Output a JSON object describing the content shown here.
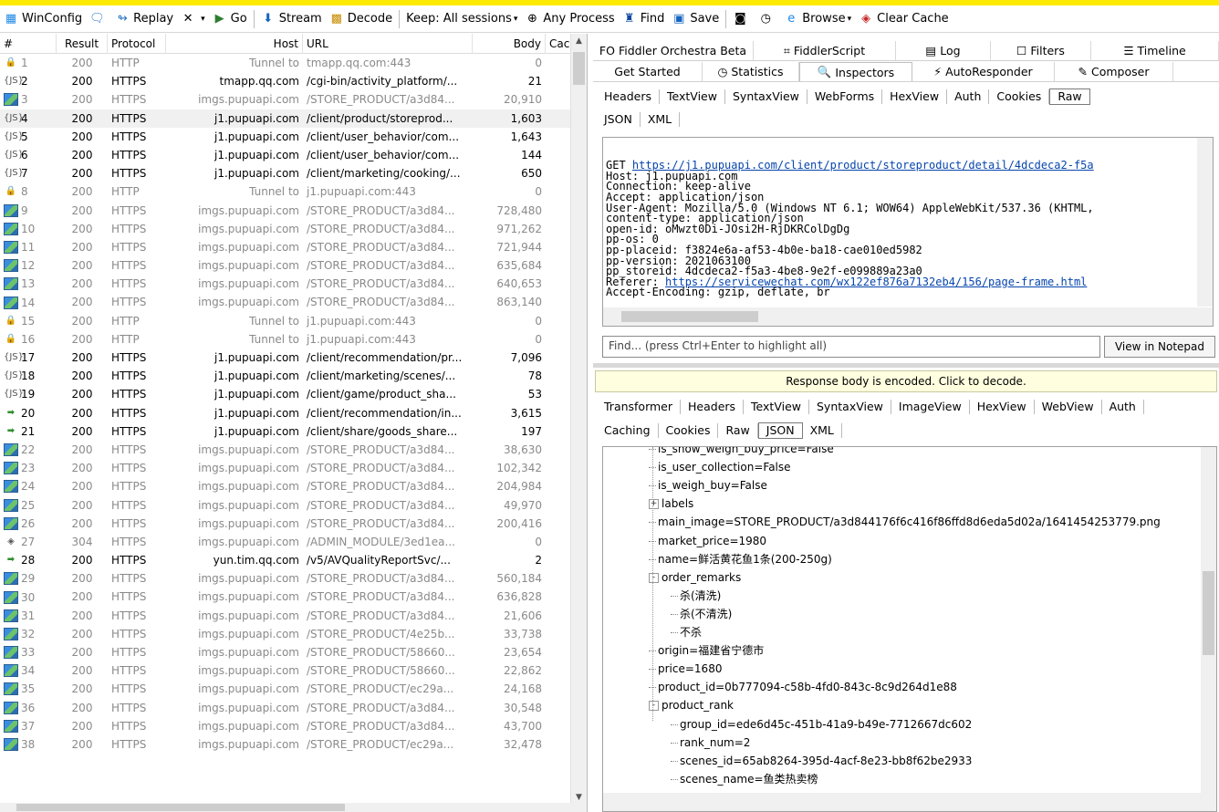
{
  "toolbar": {
    "winconfig": "WinConfig",
    "replay": "Replay",
    "go": "Go",
    "stream": "Stream",
    "decode": "Decode",
    "keep": "Keep: All sessions",
    "any_process": "Any Process",
    "find": "Find",
    "save": "Save",
    "browse": "Browse",
    "clear_cache": "Clear Cache"
  },
  "columns": [
    "#",
    "Result",
    "Protocol",
    "Host",
    "URL",
    "Body",
    "Cach"
  ],
  "sessions": [
    {
      "num": "1",
      "icon": "lock",
      "result": "200",
      "protocol": "HTTP",
      "host": "Tunnel to",
      "url": "tmapp.qq.com:443",
      "body": "0",
      "gray": true
    },
    {
      "num": "2",
      "icon": "json",
      "result": "200",
      "protocol": "HTTPS",
      "host": "tmapp.qq.com",
      "url": "/cgi-bin/activity_platform/...",
      "body": "21",
      "gray": false
    },
    {
      "num": "3",
      "icon": "img",
      "result": "200",
      "protocol": "HTTPS",
      "host": "imgs.pupuapi.com",
      "url": "/STORE_PRODUCT/a3d84...",
      "body": "20,910",
      "gray": true
    },
    {
      "num": "4",
      "icon": "json",
      "result": "200",
      "protocol": "HTTPS",
      "host": "j1.pupuapi.com",
      "url": "/client/product/storeprod...",
      "body": "1,603",
      "gray": false,
      "selected": true
    },
    {
      "num": "5",
      "icon": "json",
      "result": "200",
      "protocol": "HTTPS",
      "host": "j1.pupuapi.com",
      "url": "/client/user_behavior/com...",
      "body": "1,643",
      "gray": false
    },
    {
      "num": "6",
      "icon": "json",
      "result": "200",
      "protocol": "HTTPS",
      "host": "j1.pupuapi.com",
      "url": "/client/user_behavior/com...",
      "body": "144",
      "gray": false
    },
    {
      "num": "7",
      "icon": "json",
      "result": "200",
      "protocol": "HTTPS",
      "host": "j1.pupuapi.com",
      "url": "/client/marketing/cooking/...",
      "body": "650",
      "gray": false
    },
    {
      "num": "8",
      "icon": "lock",
      "result": "200",
      "protocol": "HTTP",
      "host": "Tunnel to",
      "url": "j1.pupuapi.com:443",
      "body": "0",
      "gray": true
    },
    {
      "num": "9",
      "icon": "img",
      "result": "200",
      "protocol": "HTTPS",
      "host": "imgs.pupuapi.com",
      "url": "/STORE_PRODUCT/a3d84...",
      "body": "728,480",
      "gray": true
    },
    {
      "num": "10",
      "icon": "img",
      "result": "200",
      "protocol": "HTTPS",
      "host": "imgs.pupuapi.com",
      "url": "/STORE_PRODUCT/a3d84...",
      "body": "971,262",
      "gray": true
    },
    {
      "num": "11",
      "icon": "img",
      "result": "200",
      "protocol": "HTTPS",
      "host": "imgs.pupuapi.com",
      "url": "/STORE_PRODUCT/a3d84...",
      "body": "721,944",
      "gray": true
    },
    {
      "num": "12",
      "icon": "img",
      "result": "200",
      "protocol": "HTTPS",
      "host": "imgs.pupuapi.com",
      "url": "/STORE_PRODUCT/a3d84...",
      "body": "635,684",
      "gray": true
    },
    {
      "num": "13",
      "icon": "img",
      "result": "200",
      "protocol": "HTTPS",
      "host": "imgs.pupuapi.com",
      "url": "/STORE_PRODUCT/a3d84...",
      "body": "640,653",
      "gray": true
    },
    {
      "num": "14",
      "icon": "img",
      "result": "200",
      "protocol": "HTTPS",
      "host": "imgs.pupuapi.com",
      "url": "/STORE_PRODUCT/a3d84...",
      "body": "863,140",
      "gray": true
    },
    {
      "num": "15",
      "icon": "lock",
      "result": "200",
      "protocol": "HTTP",
      "host": "Tunnel to",
      "url": "j1.pupuapi.com:443",
      "body": "0",
      "gray": true
    },
    {
      "num": "16",
      "icon": "lock",
      "result": "200",
      "protocol": "HTTP",
      "host": "Tunnel to",
      "url": "j1.pupuapi.com:443",
      "body": "0",
      "gray": true
    },
    {
      "num": "17",
      "icon": "json",
      "result": "200",
      "protocol": "HTTPS",
      "host": "j1.pupuapi.com",
      "url": "/client/recommendation/pr...",
      "body": "7,096",
      "gray": false
    },
    {
      "num": "18",
      "icon": "json",
      "result": "200",
      "protocol": "HTTPS",
      "host": "j1.pupuapi.com",
      "url": "/client/marketing/scenes/...",
      "body": "78",
      "gray": false
    },
    {
      "num": "19",
      "icon": "json",
      "result": "200",
      "protocol": "HTTPS",
      "host": "j1.pupuapi.com",
      "url": "/client/game/product_sha...",
      "body": "53",
      "gray": false
    },
    {
      "num": "20",
      "icon": "arrow",
      "result": "200",
      "protocol": "HTTPS",
      "host": "j1.pupuapi.com",
      "url": "/client/recommendation/in...",
      "body": "3,615",
      "gray": false
    },
    {
      "num": "21",
      "icon": "arrow",
      "result": "200",
      "protocol": "HTTPS",
      "host": "j1.pupuapi.com",
      "url": "/client/share/goods_share...",
      "body": "197",
      "gray": false
    },
    {
      "num": "22",
      "icon": "img",
      "result": "200",
      "protocol": "HTTPS",
      "host": "imgs.pupuapi.com",
      "url": "/STORE_PRODUCT/a3d84...",
      "body": "38,630",
      "gray": true
    },
    {
      "num": "23",
      "icon": "img",
      "result": "200",
      "protocol": "HTTPS",
      "host": "imgs.pupuapi.com",
      "url": "/STORE_PRODUCT/a3d84...",
      "body": "102,342",
      "gray": true
    },
    {
      "num": "24",
      "icon": "img",
      "result": "200",
      "protocol": "HTTPS",
      "host": "imgs.pupuapi.com",
      "url": "/STORE_PRODUCT/a3d84...",
      "body": "204,984",
      "gray": true
    },
    {
      "num": "25",
      "icon": "img",
      "result": "200",
      "protocol": "HTTPS",
      "host": "imgs.pupuapi.com",
      "url": "/STORE_PRODUCT/a3d84...",
      "body": "49,970",
      "gray": true
    },
    {
      "num": "26",
      "icon": "img",
      "result": "200",
      "protocol": "HTTPS",
      "host": "imgs.pupuapi.com",
      "url": "/STORE_PRODUCT/a3d84...",
      "body": "200,416",
      "gray": true
    },
    {
      "num": "27",
      "icon": "304",
      "result": "304",
      "protocol": "HTTPS",
      "host": "imgs.pupuapi.com",
      "url": "/ADMIN_MODULE/3ed1ea...",
      "body": "0",
      "gray": true
    },
    {
      "num": "28",
      "icon": "arrow",
      "result": "200",
      "protocol": "HTTPS",
      "host": "yun.tim.qq.com",
      "url": "/v5/AVQualityReportSvc/...",
      "body": "2",
      "gray": false
    },
    {
      "num": "29",
      "icon": "img",
      "result": "200",
      "protocol": "HTTPS",
      "host": "imgs.pupuapi.com",
      "url": "/STORE_PRODUCT/a3d84...",
      "body": "560,184",
      "gray": true
    },
    {
      "num": "30",
      "icon": "img",
      "result": "200",
      "protocol": "HTTPS",
      "host": "imgs.pupuapi.com",
      "url": "/STORE_PRODUCT/a3d84...",
      "body": "636,828",
      "gray": true
    },
    {
      "num": "31",
      "icon": "img",
      "result": "200",
      "protocol": "HTTPS",
      "host": "imgs.pupuapi.com",
      "url": "/STORE_PRODUCT/a3d84...",
      "body": "21,606",
      "gray": true
    },
    {
      "num": "32",
      "icon": "img",
      "result": "200",
      "protocol": "HTTPS",
      "host": "imgs.pupuapi.com",
      "url": "/STORE_PRODUCT/4e25b...",
      "body": "33,738",
      "gray": true
    },
    {
      "num": "33",
      "icon": "img",
      "result": "200",
      "protocol": "HTTPS",
      "host": "imgs.pupuapi.com",
      "url": "/STORE_PRODUCT/58660...",
      "body": "23,654",
      "gray": true
    },
    {
      "num": "34",
      "icon": "img",
      "result": "200",
      "protocol": "HTTPS",
      "host": "imgs.pupuapi.com",
      "url": "/STORE_PRODUCT/58660...",
      "body": "22,862",
      "gray": true
    },
    {
      "num": "35",
      "icon": "img",
      "result": "200",
      "protocol": "HTTPS",
      "host": "imgs.pupuapi.com",
      "url": "/STORE_PRODUCT/ec29a...",
      "body": "24,168",
      "gray": true
    },
    {
      "num": "36",
      "icon": "img",
      "result": "200",
      "protocol": "HTTPS",
      "host": "imgs.pupuapi.com",
      "url": "/STORE_PRODUCT/a3d84...",
      "body": "30,548",
      "gray": true
    },
    {
      "num": "37",
      "icon": "img",
      "result": "200",
      "protocol": "HTTPS",
      "host": "imgs.pupuapi.com",
      "url": "/STORE_PRODUCT/a3d84...",
      "body": "43,700",
      "gray": true
    },
    {
      "num": "38",
      "icon": "img",
      "result": "200",
      "protocol": "HTTPS",
      "host": "imgs.pupuapi.com",
      "url": "/STORE_PRODUCT/ec29a...",
      "body": "32,478",
      "gray": true
    }
  ],
  "right": {
    "top_tabs1": [
      "Fiddler Orchestra Beta",
      "FiddlerScript",
      "Log",
      "Filters",
      "Timeline"
    ],
    "top_tabs2": [
      "Get Started",
      "Statistics",
      "Inspectors",
      "AutoResponder",
      "Composer"
    ],
    "request_tabs": [
      "Headers",
      "TextView",
      "SyntaxView",
      "WebForms",
      "HexView",
      "Auth",
      "Cookies",
      "Raw"
    ],
    "request_tabs2": [
      "JSON",
      "XML"
    ],
    "raw_lines": [
      {
        "pre": "GET ",
        "link": "https://j1.pupuapi.com/client/product/storeproduct/detail/4dcdeca2-f5a"
      },
      {
        "pre": "Host: j1.pupuapi.com"
      },
      {
        "pre": "Connection: keep-alive"
      },
      {
        "pre": "Accept: application/json"
      },
      {
        "pre": "User-Agent: Mozilla/5.0 (Windows NT 6.1; WOW64) AppleWebKit/537.36 (KHTML,"
      },
      {
        "pre": "content-type: application/json"
      },
      {
        "pre": "open-id: oMwzt0Di-JOsi2H-RjDKRColDgDg"
      },
      {
        "pre": "pp-os: 0"
      },
      {
        "pre": "pp-placeid: f3824e6a-af53-4b0e-ba18-cae010ed5982"
      },
      {
        "pre": "pp-version: 2021063100"
      },
      {
        "pre": "pp_storeid: 4dcdeca2-f5a3-4be8-9e2f-e099889a23a0"
      },
      {
        "pre": "Referer: ",
        "link": "https://servicewechat.com/wx122ef876a7132eb4/156/page-frame.html"
      },
      {
        "pre": "Accept-Encoding: gzip, deflate, br"
      }
    ],
    "find_placeholder": "Find... (press Ctrl+Enter to highlight all)",
    "view_notepad": "View in Notepad",
    "banner": "Response body is encoded. Click to decode.",
    "response_tabs": [
      "Transformer",
      "Headers",
      "TextView",
      "SyntaxView",
      "ImageView",
      "HexView",
      "WebView",
      "Auth"
    ],
    "response_tabs2": [
      "Caching",
      "Cookies",
      "Raw",
      "JSON",
      "XML"
    ],
    "tree": [
      {
        "text": "is_show_weigh_buy_price=False",
        "level": 0
      },
      {
        "text": "is_user_collection=False",
        "level": 0
      },
      {
        "text": "is_weigh_buy=False",
        "level": 0
      },
      {
        "text": "labels",
        "level": 0,
        "toggle": "+"
      },
      {
        "text": "main_image=STORE_PRODUCT/a3d844176f6c416f86ffd8d6eda5d02a/1641454253779.png",
        "level": 0
      },
      {
        "text": "market_price=1980",
        "level": 0
      },
      {
        "text": "name=鲜活黄花鱼1条(200-250g)",
        "level": 0
      },
      {
        "text": "order_remarks",
        "level": 0,
        "toggle": "-"
      },
      {
        "text": "杀(清洗)",
        "level": 1
      },
      {
        "text": "杀(不清洗)",
        "level": 1
      },
      {
        "text": "不杀",
        "level": 1
      },
      {
        "text": "origin=福建省宁德市",
        "level": 0
      },
      {
        "text": "price=1680",
        "level": 0
      },
      {
        "text": "product_id=0b777094-c58b-4fd0-843c-8c9d264d1e88",
        "level": 0
      },
      {
        "text": "product_rank",
        "level": 0,
        "toggle": "-"
      },
      {
        "text": "group_id=ede6d45c-451b-41a9-b49e-7712667dc602",
        "level": 1
      },
      {
        "text": "rank_num=2",
        "level": 1
      },
      {
        "text": "scenes_id=65ab8264-395d-4acf-8e23-bb8f62be2933",
        "level": 1
      },
      {
        "text": "scenes_name=鱼类热卖榜",
        "level": 1
      }
    ]
  }
}
